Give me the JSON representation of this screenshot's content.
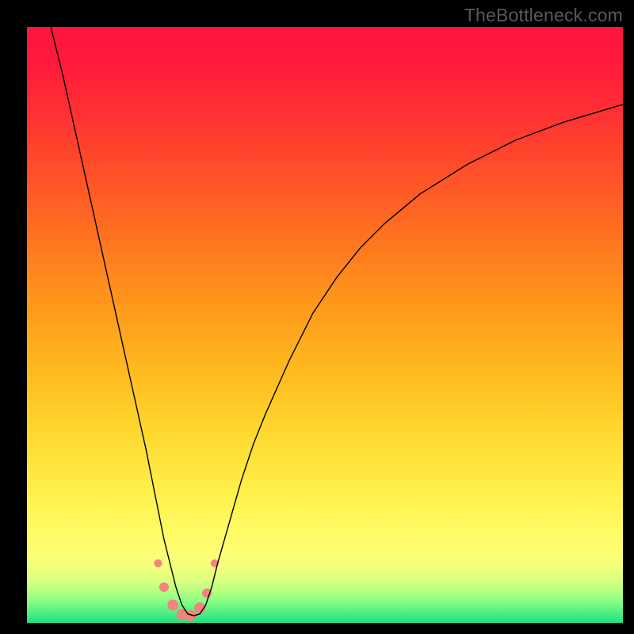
{
  "watermark": "TheBottleneck.com",
  "gradient_stops": [
    {
      "offset": 0.0,
      "color": "#ff153e"
    },
    {
      "offset": 0.06,
      "color": "#ff1a3c"
    },
    {
      "offset": 0.14,
      "color": "#ff2f34"
    },
    {
      "offset": 0.24,
      "color": "#ff4e29"
    },
    {
      "offset": 0.35,
      "color": "#ff7220"
    },
    {
      "offset": 0.46,
      "color": "#ff961b"
    },
    {
      "offset": 0.57,
      "color": "#ffb81e"
    },
    {
      "offset": 0.67,
      "color": "#ffd52d"
    },
    {
      "offset": 0.76,
      "color": "#ffeb45"
    },
    {
      "offset": 0.83,
      "color": "#fff95e"
    },
    {
      "offset": 0.875,
      "color": "#fffe70"
    },
    {
      "offset": 0.905,
      "color": "#f4ff7a"
    },
    {
      "offset": 0.928,
      "color": "#daff80"
    },
    {
      "offset": 0.948,
      "color": "#b3ff82"
    },
    {
      "offset": 0.965,
      "color": "#86fd83"
    },
    {
      "offset": 0.985,
      "color": "#48ee83"
    },
    {
      "offset": 1.0,
      "color": "#1de181"
    }
  ],
  "chart_data": {
    "type": "line",
    "title": "",
    "xlabel": "",
    "ylabel": "",
    "xlim": [
      0,
      100
    ],
    "ylim": [
      0,
      100
    ],
    "series": [
      {
        "name": "bottleneck-curve",
        "x": [
          4,
          6,
          8,
          10,
          12,
          14,
          16,
          18,
          20,
          22,
          23,
          24,
          25,
          26,
          27,
          28,
          29,
          30,
          31,
          32,
          34,
          36,
          38,
          40,
          44,
          48,
          52,
          56,
          60,
          66,
          74,
          82,
          90,
          100
        ],
        "y": [
          100,
          92,
          83,
          74,
          65,
          56,
          47,
          38,
          29,
          19,
          14,
          10,
          6,
          3,
          1.5,
          1.2,
          1.5,
          3,
          6,
          10,
          17,
          24,
          30,
          35,
          44,
          52,
          58,
          63,
          67,
          72,
          77,
          81,
          84,
          87
        ]
      }
    ],
    "markers": {
      "name": "bottom-dots",
      "color": "#f4827e",
      "points": [
        {
          "x": 22.0,
          "y": 10.0,
          "r": 5
        },
        {
          "x": 23.0,
          "y": 6.0,
          "r": 6
        },
        {
          "x": 24.5,
          "y": 3.0,
          "r": 7
        },
        {
          "x": 26.0,
          "y": 1.4,
          "r": 7
        },
        {
          "x": 27.5,
          "y": 1.2,
          "r": 7
        },
        {
          "x": 29.0,
          "y": 2.5,
          "r": 7
        },
        {
          "x": 30.2,
          "y": 5.0,
          "r": 6
        },
        {
          "x": 31.5,
          "y": 10.0,
          "r": 5
        }
      ]
    }
  }
}
